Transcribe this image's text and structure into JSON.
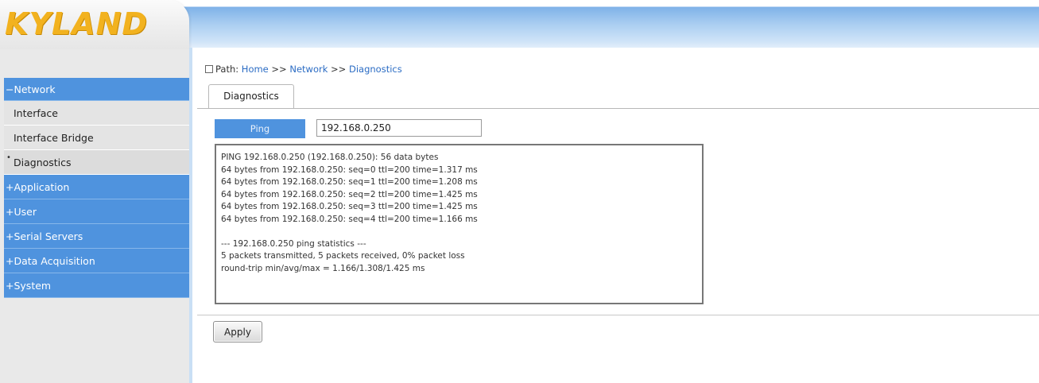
{
  "header": {
    "logo_text": "KYLAND"
  },
  "sidebar": {
    "items": [
      {
        "label": "−Network",
        "type": "group"
      },
      {
        "label": "Interface",
        "type": "sub"
      },
      {
        "label": "Interface Bridge",
        "type": "sub"
      },
      {
        "label": "Diagnostics",
        "type": "sub",
        "active": true
      },
      {
        "label": "+Application",
        "type": "group"
      },
      {
        "label": "+User",
        "type": "group"
      },
      {
        "label": "+Serial Servers",
        "type": "group"
      },
      {
        "label": "+Data Acquisition",
        "type": "group"
      },
      {
        "label": "+System",
        "type": "group"
      }
    ]
  },
  "path": {
    "label": "Path:",
    "home": "Home",
    "sep1": ">>",
    "network": "Network",
    "sep2": ">>",
    "diagnostics": "Diagnostics"
  },
  "tab": {
    "label": "Diagnostics"
  },
  "ping": {
    "button_label": "Ping",
    "ip_value": "192.168.0.250"
  },
  "output": {
    "lines": [
      "PING 192.168.0.250 (192.168.0.250): 56 data bytes",
      "64 bytes from 192.168.0.250: seq=0 ttl=200 time=1.317 ms",
      "64 bytes from 192.168.0.250: seq=1 ttl=200 time=1.208 ms",
      "64 bytes from 192.168.0.250: seq=2 ttl=200 time=1.425 ms",
      "64 bytes from 192.168.0.250: seq=3 ttl=200 time=1.425 ms",
      "64 bytes from 192.168.0.250: seq=4 ttl=200 time=1.166 ms",
      "",
      "--- 192.168.0.250 ping statistics ---",
      "5 packets transmitted, 5 packets received, 0% packet loss",
      "round-trip min/avg/max = 1.166/1.308/1.425 ms"
    ]
  },
  "apply": {
    "label": "Apply"
  },
  "colors": {
    "accent": "#4f93de",
    "logo": "#f2b21f",
    "header_gradient_top": "#7fb2e8"
  }
}
